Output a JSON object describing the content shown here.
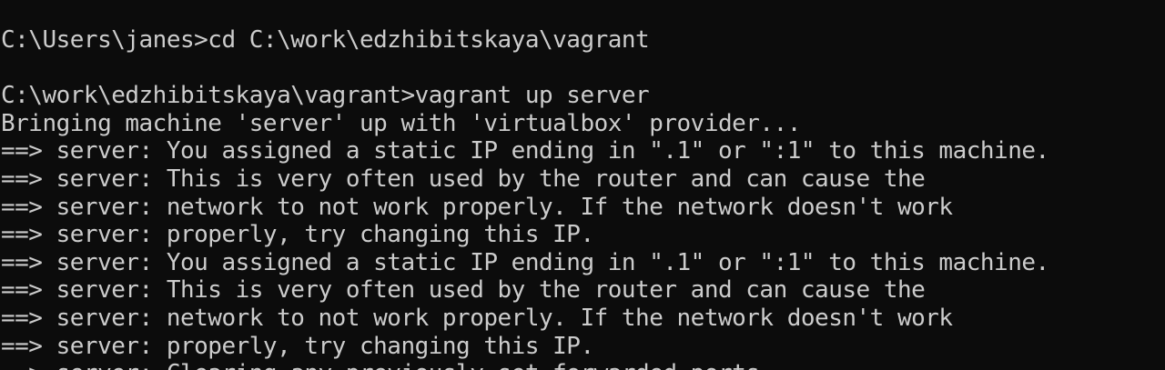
{
  "terminal": {
    "lines": [
      "C:\\Users\\janes>cd C:\\work\\edzhibitskaya\\vagrant",
      "",
      "C:\\work\\edzhibitskaya\\vagrant>vagrant up server",
      "Bringing machine 'server' up with 'virtualbox' provider...",
      "==> server: You assigned a static IP ending in \".1\" or \":1\" to this machine.",
      "==> server: This is very often used by the router and can cause the",
      "==> server: network to not work properly. If the network doesn't work",
      "==> server: properly, try changing this IP.",
      "==> server: You assigned a static IP ending in \".1\" or \":1\" to this machine.",
      "==> server: This is very often used by the router and can cause the",
      "==> server: network to not work properly. If the network doesn't work",
      "==> server: properly, try changing this IP.",
      "==> server: Clearing any previously set forwarded ports..."
    ]
  },
  "colors": {
    "background": "#0c0c0c",
    "foreground": "#cccccc"
  }
}
